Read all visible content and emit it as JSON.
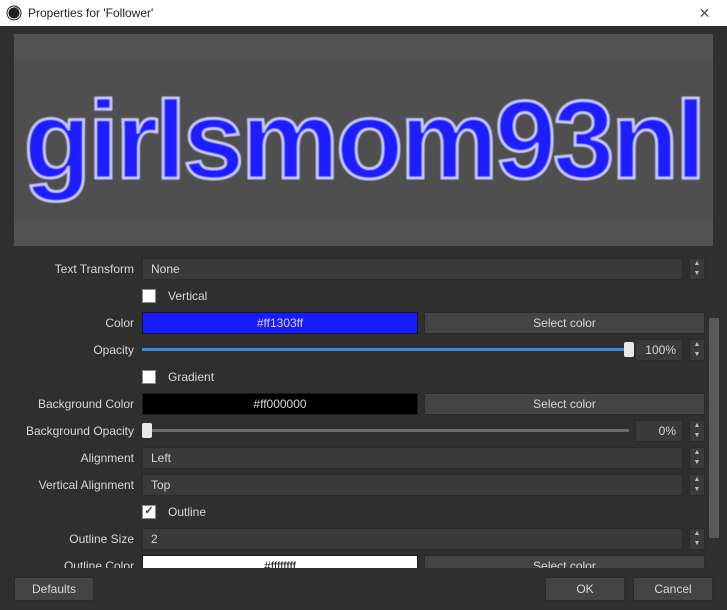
{
  "title": "Properties for 'Follower'",
  "preview_text": "girlsmom93nl",
  "colors": {
    "text": "#ff1303ff",
    "text_swatch_bg": "#1a1aff",
    "background": "#ff000000",
    "background_swatch_bg": "#000000",
    "outline": "#ffffffff",
    "outline_swatch_bg": "#ffffff",
    "outline_text_color": "#111111"
  },
  "labels": {
    "text_transform": "Text Transform",
    "vertical": "Vertical",
    "color": "Color",
    "opacity": "Opacity",
    "gradient": "Gradient",
    "background_color": "Background Color",
    "background_opacity": "Background Opacity",
    "alignment": "Alignment",
    "vertical_alignment": "Vertical Alignment",
    "outline": "Outline",
    "outline_size": "Outline Size",
    "outline_color": "Outline Color"
  },
  "buttons": {
    "select_color": "Select color",
    "defaults": "Defaults",
    "ok": "OK",
    "cancel": "Cancel"
  },
  "values": {
    "text_transform": "None",
    "vertical": false,
    "opacity_pct": "100%",
    "opacity_fill_pct": 100,
    "gradient": false,
    "bg_opacity_pct": "0%",
    "bg_opacity_fill_pct": 0,
    "alignment": "Left",
    "vertical_alignment": "Top",
    "outline": true,
    "outline_size": "2"
  }
}
